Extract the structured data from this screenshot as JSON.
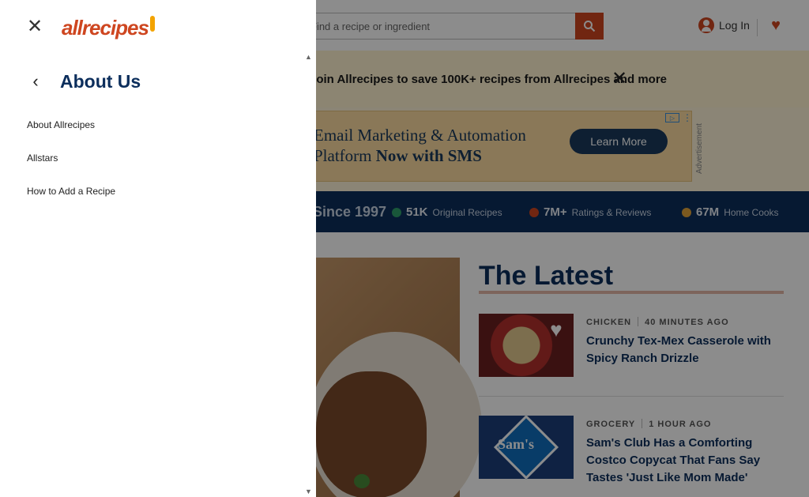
{
  "header": {
    "search_placeholder": "Find a recipe or ingredient",
    "login_label": "Log In"
  },
  "promo": {
    "text": "Join Allrecipes to save 100K+ recipes from Allrecipes and more",
    "close_icon": "close-icon"
  },
  "ad": {
    "line1": "Email Marketing & Automation",
    "line2_prefix": "Platform ",
    "line2_bold": "Now with SMS",
    "cta": "Learn More",
    "tag": "Advertisement"
  },
  "stats": {
    "since": "Since 1997",
    "items": [
      {
        "num": "51K",
        "label": "Original Recipes",
        "color": "#2e9f6b"
      },
      {
        "num": "7M+",
        "label": "Ratings & Reviews",
        "color": "#ce4620"
      },
      {
        "num": "67M",
        "label": "Home Cooks",
        "color": "#e0a33a"
      }
    ]
  },
  "latest": {
    "title": "The Latest",
    "cards": [
      {
        "category": "CHICKEN",
        "time": "40 MINUTES AGO",
        "title": "Crunchy Tex-Mex Casserole with Spicy Ranch Drizzle"
      },
      {
        "category": "GROCERY",
        "time": "1 HOUR AGO",
        "title": "Sam's Club Has a Comforting Costco Copycat That Fans Say Tastes 'Just Like Mom Made'"
      }
    ],
    "sams_logo_text": "Sam's"
  },
  "menu": {
    "logo_text": "allrecipes",
    "section_title": "About Us",
    "links": [
      "About Allrecipes",
      "Allstars",
      "How to Add a Recipe"
    ]
  },
  "colors": {
    "brand": "#ce4620",
    "navy": "#0c2e5c",
    "promo_bg": "#fff3cf"
  }
}
